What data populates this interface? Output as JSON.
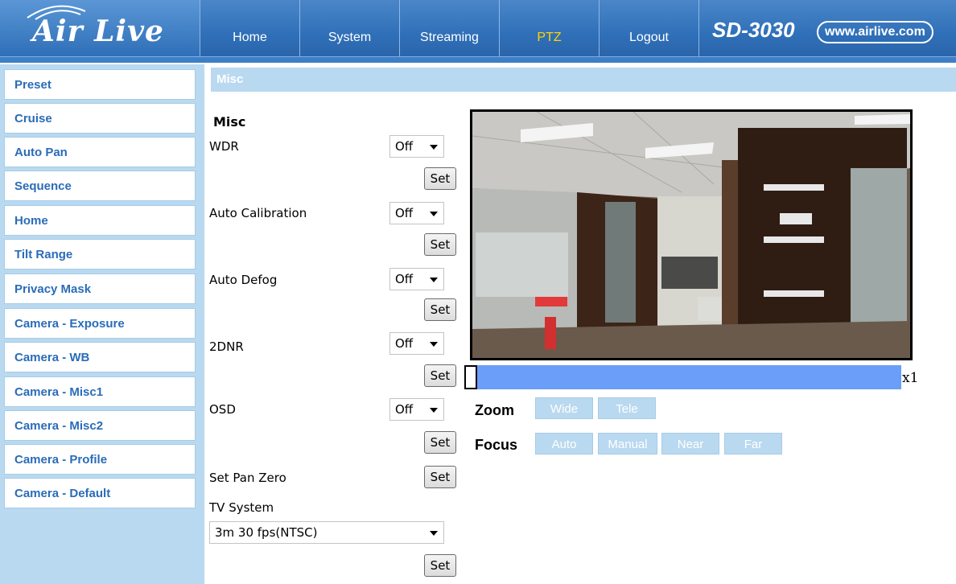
{
  "header": {
    "logo": "Air Live",
    "model": "SD-3030",
    "website": "www.airlive.com",
    "nav": [
      "Home",
      "System",
      "Streaming",
      "PTZ",
      "Logout"
    ],
    "active_nav": "PTZ"
  },
  "sidebar": {
    "items": [
      "Preset",
      "Cruise",
      "Auto Pan",
      "Sequence",
      "Home",
      "Tilt Range",
      "Privacy Mask",
      "Camera - Exposure",
      "Camera - WB",
      "Camera - Misc1",
      "Camera - Misc2",
      "Camera - Profile",
      "Camera - Default"
    ]
  },
  "main": {
    "section_title": "Misc",
    "heading": "Misc",
    "settings": {
      "wdr": {
        "label": "WDR",
        "value": "Off"
      },
      "auto_calibration": {
        "label": "Auto Calibration",
        "value": "Off"
      },
      "auto_defog": {
        "label": "Auto Defog",
        "value": "Off"
      },
      "dnr": {
        "label": "2DNR",
        "value": "Off"
      },
      "osd": {
        "label": "OSD",
        "value": "Off"
      },
      "set_pan_zero": {
        "label": "Set Pan Zero"
      },
      "tv_system": {
        "label": "TV System",
        "value": "3m 30 fps(NTSC)"
      }
    },
    "set_label": "Set"
  },
  "video": {
    "zoom_value": "x1",
    "zoom_level_fraction": 0.0,
    "zoom": {
      "label": "Zoom",
      "wide": "Wide",
      "tele": "Tele"
    },
    "focus": {
      "label": "Focus",
      "auto": "Auto",
      "manual": "Manual",
      "near": "Near",
      "far": "Far"
    }
  },
  "colors": {
    "header_blue": "#2f6fb8",
    "active_nav": "#ffd400",
    "sidebar_bg": "#b9d9f0",
    "sidebar_text": "#2a6cb8",
    "zoom_bar": "#6a9ef8"
  }
}
